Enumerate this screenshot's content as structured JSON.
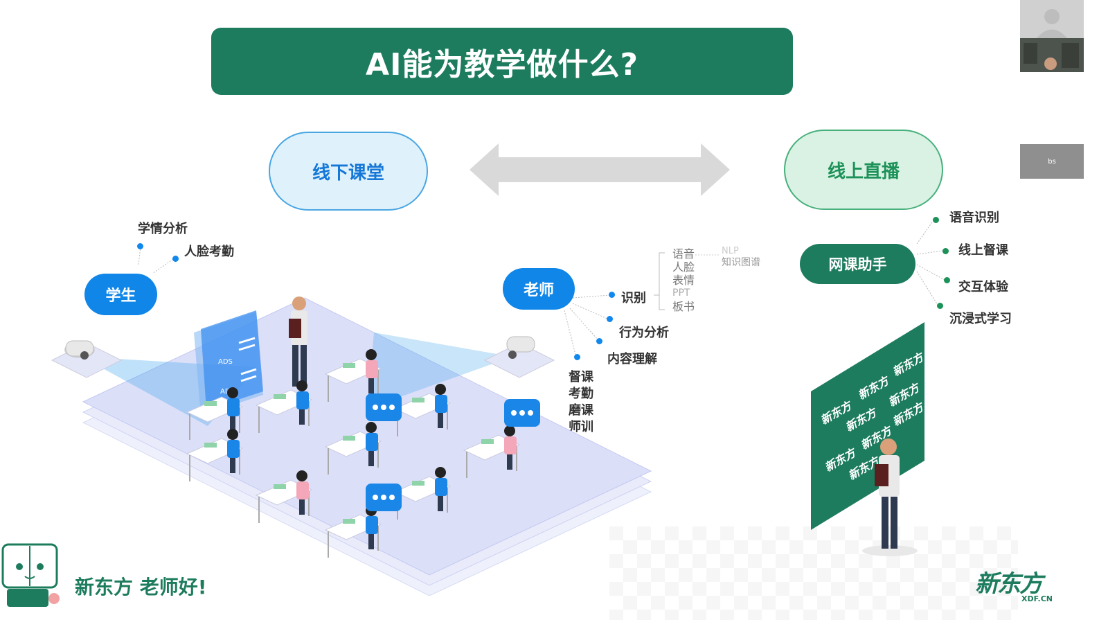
{
  "slide": {
    "title": "AI能为教学做什么?",
    "offline_label": "线下课堂",
    "online_label": "线上直播",
    "student": {
      "label": "学生",
      "features": [
        "学情分析",
        "人脸考勤"
      ]
    },
    "teacher": {
      "label": "老师",
      "branches": [
        "识别",
        "行为分析",
        "内容理解"
      ],
      "recognition_items": [
        "语音",
        "人脸",
        "表情",
        "PPT",
        "板书"
      ],
      "recognition_sub": [
        "NLP",
        "知识图谱"
      ],
      "extra_items": [
        "督课",
        "考勤",
        "磨课",
        "师训"
      ]
    },
    "online_assistant": {
      "label": "网课助手",
      "features": [
        "语音识别",
        "线上督课",
        "交互体验",
        "沉浸式学习"
      ]
    },
    "footer_slogan": "新东方 老师好!",
    "brand_cn": "新东方",
    "brand_en": "XDF.CN",
    "board_logo_text": "新东方",
    "classroom_screen_text": "ADS"
  },
  "overlay": {
    "side_tab_label": "bs"
  },
  "colors": {
    "title_bar": "#1d7c5e",
    "blue_node": "#0f86e8",
    "green_node": "#1d7c5e",
    "offline_fill": "#dff1fb",
    "online_fill": "#d9f2e4"
  }
}
